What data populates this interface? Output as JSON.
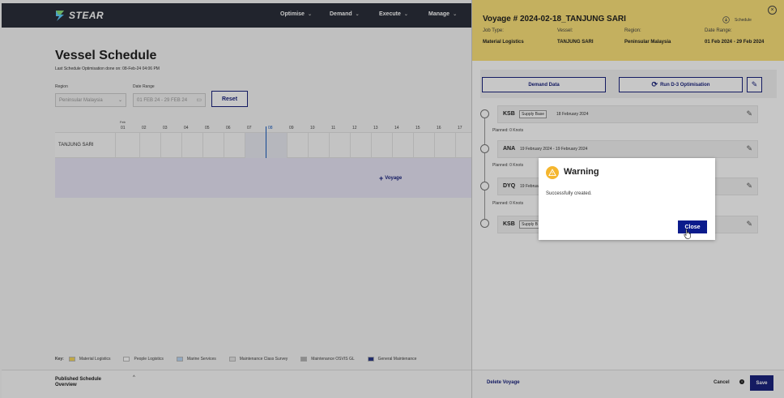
{
  "app": {
    "logo_text": "STEAR",
    "nav": [
      {
        "label": "Optimise"
      },
      {
        "label": "Demand"
      },
      {
        "label": "Execute"
      },
      {
        "label": "Manage"
      }
    ]
  },
  "page": {
    "title": "Vessel Schedule",
    "last_optimisation": "Last Schedule Optimisation done on: 08-Feb-24 04:06 PM",
    "region_label": "Region",
    "region_value": "Peninsular Malaysia",
    "date_range_label": "Date Range",
    "date_range_value": "01 FEB 24 - 29 FEB 24",
    "reset_label": "Reset",
    "month_label": "Feb",
    "days": [
      "01",
      "02",
      "03",
      "04",
      "05",
      "06",
      "07",
      "08",
      "09",
      "10",
      "11",
      "12",
      "13",
      "14",
      "15",
      "16",
      "17"
    ],
    "today_day": "08",
    "vessel_row": "TANJUNG SARI",
    "add_voyage_label": "Voyage"
  },
  "key": {
    "label": "Key:",
    "items": [
      {
        "label": "Material Logistics",
        "color": "#f5d65b"
      },
      {
        "label": "People Logistics",
        "color": "#ffffff"
      },
      {
        "label": "Marine Services",
        "color": "#bcd8f5"
      },
      {
        "label": "Maintenance Class Survey",
        "color": "#e6e6e6"
      },
      {
        "label": "Maintenance OSVIS GL",
        "color": "#b4b4b4"
      },
      {
        "label": "General Maintenance",
        "color": "#2b3a8a"
      }
    ]
  },
  "bottom_panel": {
    "title": "Published Schedule Overview"
  },
  "drawer": {
    "title": "Voyage # 2024-02-18_TANJUNG SARI",
    "schedule_label": "Schedule",
    "fields": {
      "job_type_label": "Job Type:",
      "job_type_value": "Material Logistics",
      "vessel_label": "Vessel:",
      "vessel_value": "TANJUNG SARI",
      "region_label": "Region:",
      "region_value": "Peninsular Malaysia",
      "date_range_label": "Date Range:",
      "date_range_value": "01 Feb 2024 - 29 Feb 2024"
    },
    "demand_data_label": "Demand Data",
    "run_optimisation_label": "Run D-3 Optimisation",
    "stops": [
      {
        "code": "KSB",
        "tag": "Supply Base",
        "date": "18 February 2024",
        "planned": "Planned: 0 Knots"
      },
      {
        "code": "ANA",
        "tag": "",
        "date": "19 February 2024 - 19 February 2024",
        "planned": "Planned: 0 Knots"
      },
      {
        "code": "DYQ",
        "tag": "",
        "date": "19 Februa",
        "planned": "Planned: 0 Knots"
      },
      {
        "code": "KSB",
        "tag": "Supply B",
        "date": "",
        "planned": ""
      }
    ],
    "delete_label": "Delete Voyage",
    "cancel_label": "Cancel",
    "save_label": "Save"
  },
  "modal": {
    "title": "Warning",
    "message": "Successfully created.",
    "close_label": "Close"
  },
  "colors": {
    "accent": "#1a237e",
    "drawer_header": "#fbe27a",
    "warning": "#f5b62e"
  }
}
